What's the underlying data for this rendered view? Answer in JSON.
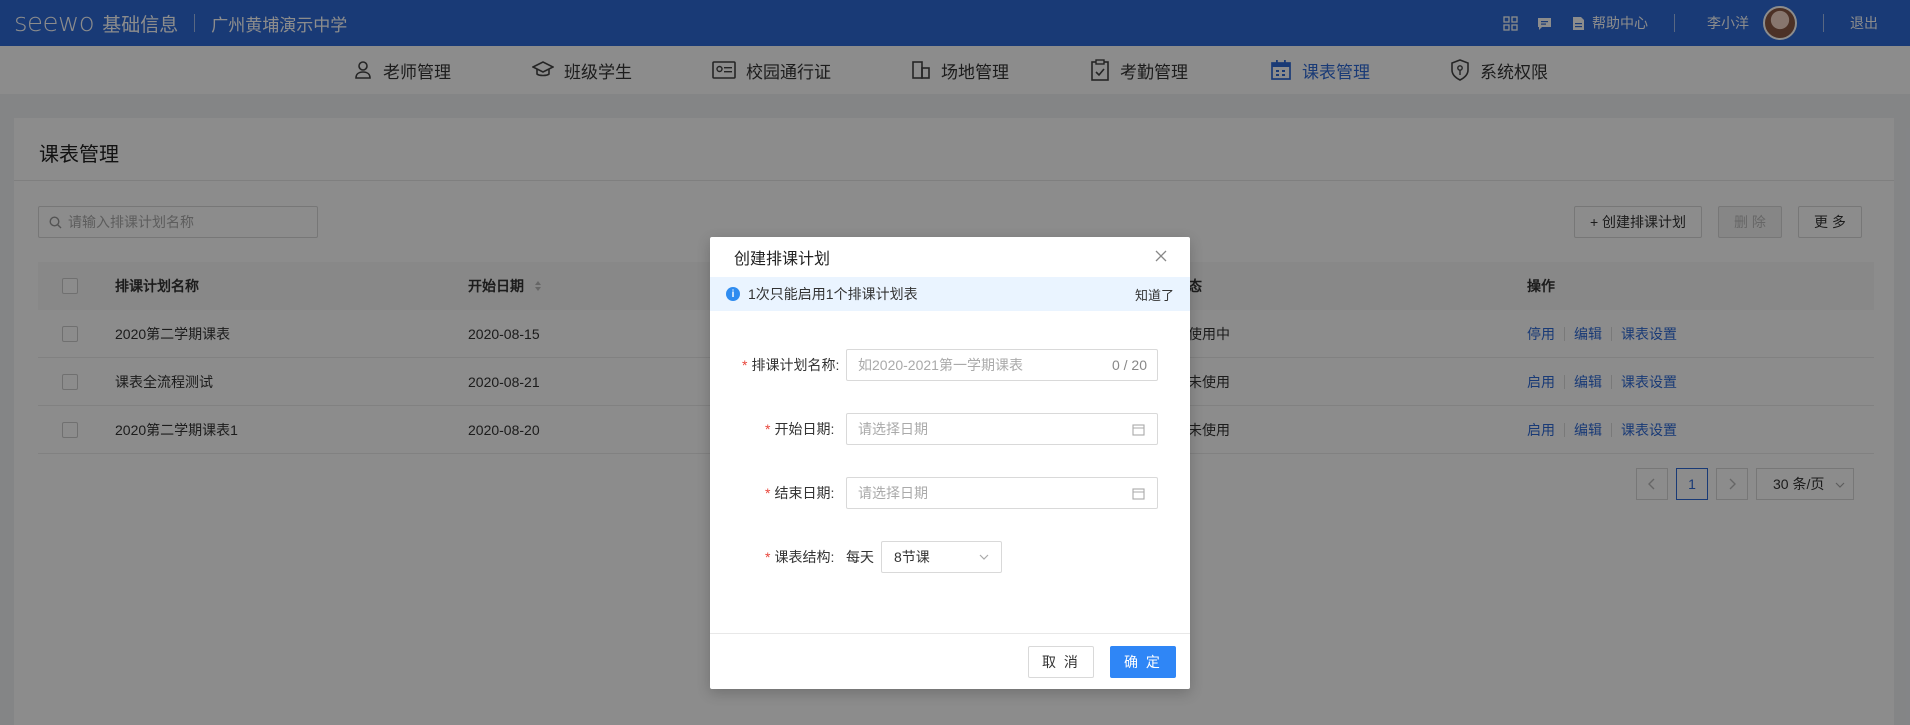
{
  "topbar": {
    "logo": "seewo",
    "product": "基础信息",
    "school": "广州黄埔演示中学",
    "help": "帮助中心",
    "user": "李小洋",
    "logout": "退出"
  },
  "nav": [
    {
      "label": "老师管理",
      "icon": "user-icon"
    },
    {
      "label": "班级学生",
      "icon": "graduation-cap-icon"
    },
    {
      "label": "校园通行证",
      "icon": "id-card-icon"
    },
    {
      "label": "场地管理",
      "icon": "building-icon"
    },
    {
      "label": "考勤管理",
      "icon": "clipboard-check-icon"
    },
    {
      "label": "课表管理",
      "icon": "calendar-icon",
      "active": true
    },
    {
      "label": "系统权限",
      "icon": "shield-icon"
    }
  ],
  "page": {
    "title": "课表管理",
    "search_placeholder": "请输入排课计划名称",
    "create_button": "+ 创建排课计划",
    "delete_button": "删 除",
    "more_button": "更 多"
  },
  "table": {
    "columns": [
      "排课计划名称",
      "开始日期",
      "态",
      "操作"
    ],
    "rows": [
      {
        "name": "2020第二学期课表",
        "start": "2020-08-15",
        "status": "使用中",
        "toggle": "停用",
        "edit": "编辑",
        "settings": "课表设置"
      },
      {
        "name": "课表全流程测试",
        "start": "2020-08-21",
        "status": "未使用",
        "toggle": "启用",
        "edit": "编辑",
        "settings": "课表设置"
      },
      {
        "name": "2020第二学期课表1",
        "start": "2020-08-20",
        "status": "未使用",
        "toggle": "启用",
        "edit": "编辑",
        "settings": "课表设置"
      }
    ]
  },
  "pagination": {
    "current": "1",
    "page_size": "30 条/页"
  },
  "modal": {
    "title": "创建排课计划",
    "notice": "1次只能启用1个排课计划表",
    "notice_ok": "知道了",
    "name_label": "排课计划名称:",
    "name_placeholder": "如2020-2021第一学期课表",
    "name_count": "0 / 20",
    "start_label": "开始日期:",
    "start_placeholder": "请选择日期",
    "end_label": "结束日期:",
    "end_placeholder": "请选择日期",
    "structure_label": "课表结构:",
    "structure_prefix": "每天",
    "structure_value": "8节课",
    "cancel": "取 消",
    "confirm": "确 定"
  },
  "colors": {
    "brand": "#2f6bd8",
    "primary_button": "#2f86f6",
    "required": "#e8463b"
  }
}
